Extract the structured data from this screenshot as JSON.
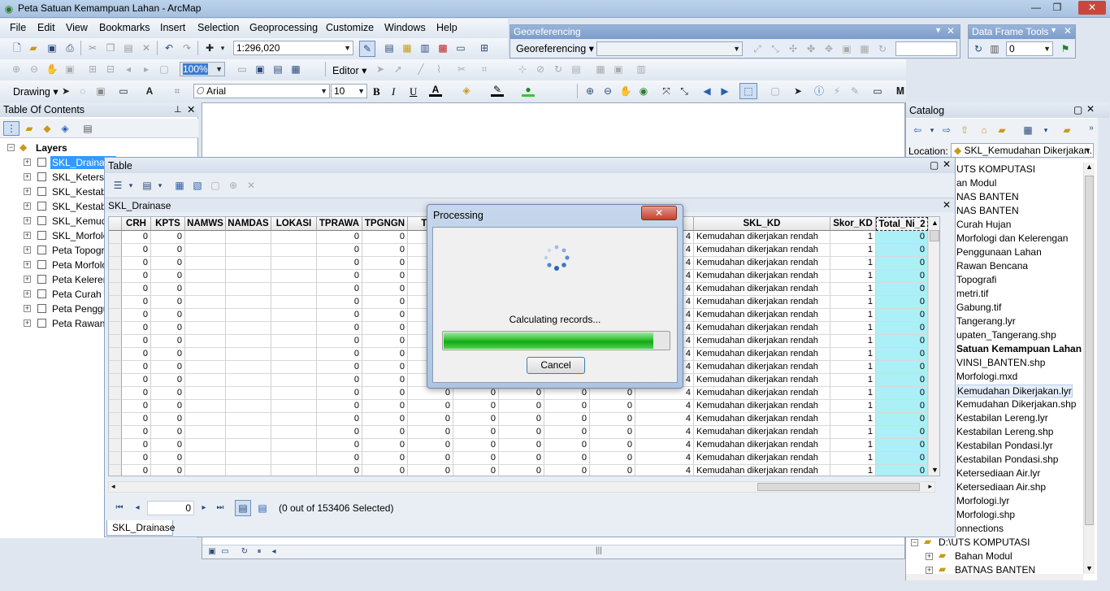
{
  "app": {
    "title": "Peta Satuan Kemampuan Lahan - ArcMap",
    "win_min": "—",
    "win_max": "❐",
    "win_close": "✕"
  },
  "menu": [
    "File",
    "Edit",
    "View",
    "Bookmarks",
    "Insert",
    "Selection",
    "Geoprocessing",
    "Customize",
    "Windows",
    "Help"
  ],
  "toolbar": {
    "scale": "1:296,020",
    "editor_label": "Editor ▾",
    "drawing_label": "Drawing ▾",
    "font_name": "Arial",
    "font_size": "10",
    "bold": "B",
    "italic": "I",
    "underline": "U",
    "zoom_pct": "100%"
  },
  "georef": {
    "title": "Georeferencing",
    "menu_label": "Georeferencing ▾"
  },
  "dataframe": {
    "title": "Data Frame Tools",
    "value": "0"
  },
  "toc": {
    "title": "Table Of Contents",
    "root": "Layers",
    "layers": [
      "SKL_Drainase",
      "SKL_Ketersediaan Air",
      "SKL_Kestabilan Lereng",
      "SKL_Kestabilan Pondasi",
      "SKL_Kemudahan Dikerjakan",
      "SKL_Morfologi",
      "Peta Topografi",
      "Peta Morfologi",
      "Peta Kelerengan",
      "Peta Curah Hujan",
      "Peta Penggunaan Lahan",
      "Peta Rawan Bencana"
    ]
  },
  "catalog": {
    "title": "Catalog",
    "location_label": "Location:",
    "location_value": "SKL_Kemudahan Dikerjakan.",
    "items": [
      "UTS KOMPUTASI",
      "an Modul",
      "NAS BANTEN",
      "NAS BANTEN",
      "Curah Hujan",
      "Morfologi dan Kelerengan",
      "Penggunaan Lahan",
      "Rawan Bencana",
      "Topografi",
      "metri.tif",
      "Gabung.tif",
      "Tangerang.lyr",
      "upaten_Tangerang.shp",
      "Satuan Kemampuan Lahan",
      "VINSI_BANTEN.shp",
      "Morfologi.mxd",
      "Kemudahan Dikerjakan.lyr",
      "Kemudahan Dikerjakan.shp",
      "Kestabilan Lereng.lyr",
      "Kestabilan Lereng.shp",
      "Kestabilan Pondasi.lyr",
      "Kestabilan Pondasi.shp",
      "Ketersediaan Air.lyr",
      "Ketersediaan Air.shp",
      "Morfologi.lyr",
      "Morfologi.shp",
      "onnections",
      "D:\\UTS KOMPUTASI",
      "Bahan Modul",
      "BATNAS BANTEN"
    ]
  },
  "table": {
    "window_title": "Table",
    "layer_name": "SKL_Drainase",
    "columns": [
      "CRH",
      "KPTS",
      "NAMWS",
      "NAMDAS",
      "LOKASI",
      "TPRAWA",
      "TPGNGN",
      "TPA",
      "SKL_KD",
      "Skor_KD",
      "Total_Ni_2"
    ],
    "cell_zero": "0",
    "cell_four": "4",
    "cell_one": "1",
    "skl_kd_value": "Kemudahan dikerjakan rendah",
    "record_number": "0",
    "selection_status": "(0 out of 153406 Selected)",
    "tab_name": "SKL_Drainase"
  },
  "processing": {
    "title": "Processing",
    "message": "Calculating records...",
    "progress": 0.93,
    "cancel_label": "Cancel",
    "close": "✕"
  }
}
